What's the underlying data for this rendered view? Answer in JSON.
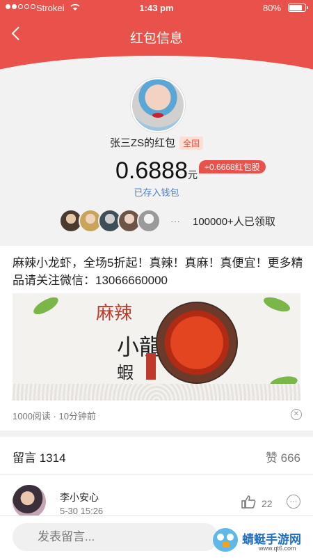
{
  "status": {
    "carrier": "Strokei",
    "time": "1:43 pm",
    "battery": "80%"
  },
  "nav": {
    "back_icon": "chevron-left-icon",
    "title": "红包信息"
  },
  "profile": {
    "name": "张三ZS的红包",
    "badge": "全国",
    "amount": "0.6888",
    "unit": "元",
    "bonus": "+0.6668红包股",
    "saved": "已存入钱包",
    "ellipsis": "···",
    "received_count": "100000+人已领取"
  },
  "post": {
    "text": "麻辣小龙虾，全场5折起！真辣！真麻！真便宜！更多精品请关注微信：13066660000",
    "banner": {
      "line1": "麻辣",
      "line2": "小龍",
      "line3": "蝦"
    },
    "meta": "1000阅读 · 10分钟前",
    "close_icon": "close-circle-icon"
  },
  "comments": {
    "label": "留言 1314",
    "likes": "赞 666",
    "items": [
      {
        "name": "李小安心",
        "date": "5-30 15:26",
        "likes": "22"
      }
    ]
  },
  "bottom": {
    "placeholder": "发表留言..."
  },
  "watermark": {
    "title": "蜻蜓手游网",
    "url": "www.qt6.com"
  },
  "colors": {
    "accent": "#e8524a",
    "link": "#4a7fc5"
  }
}
